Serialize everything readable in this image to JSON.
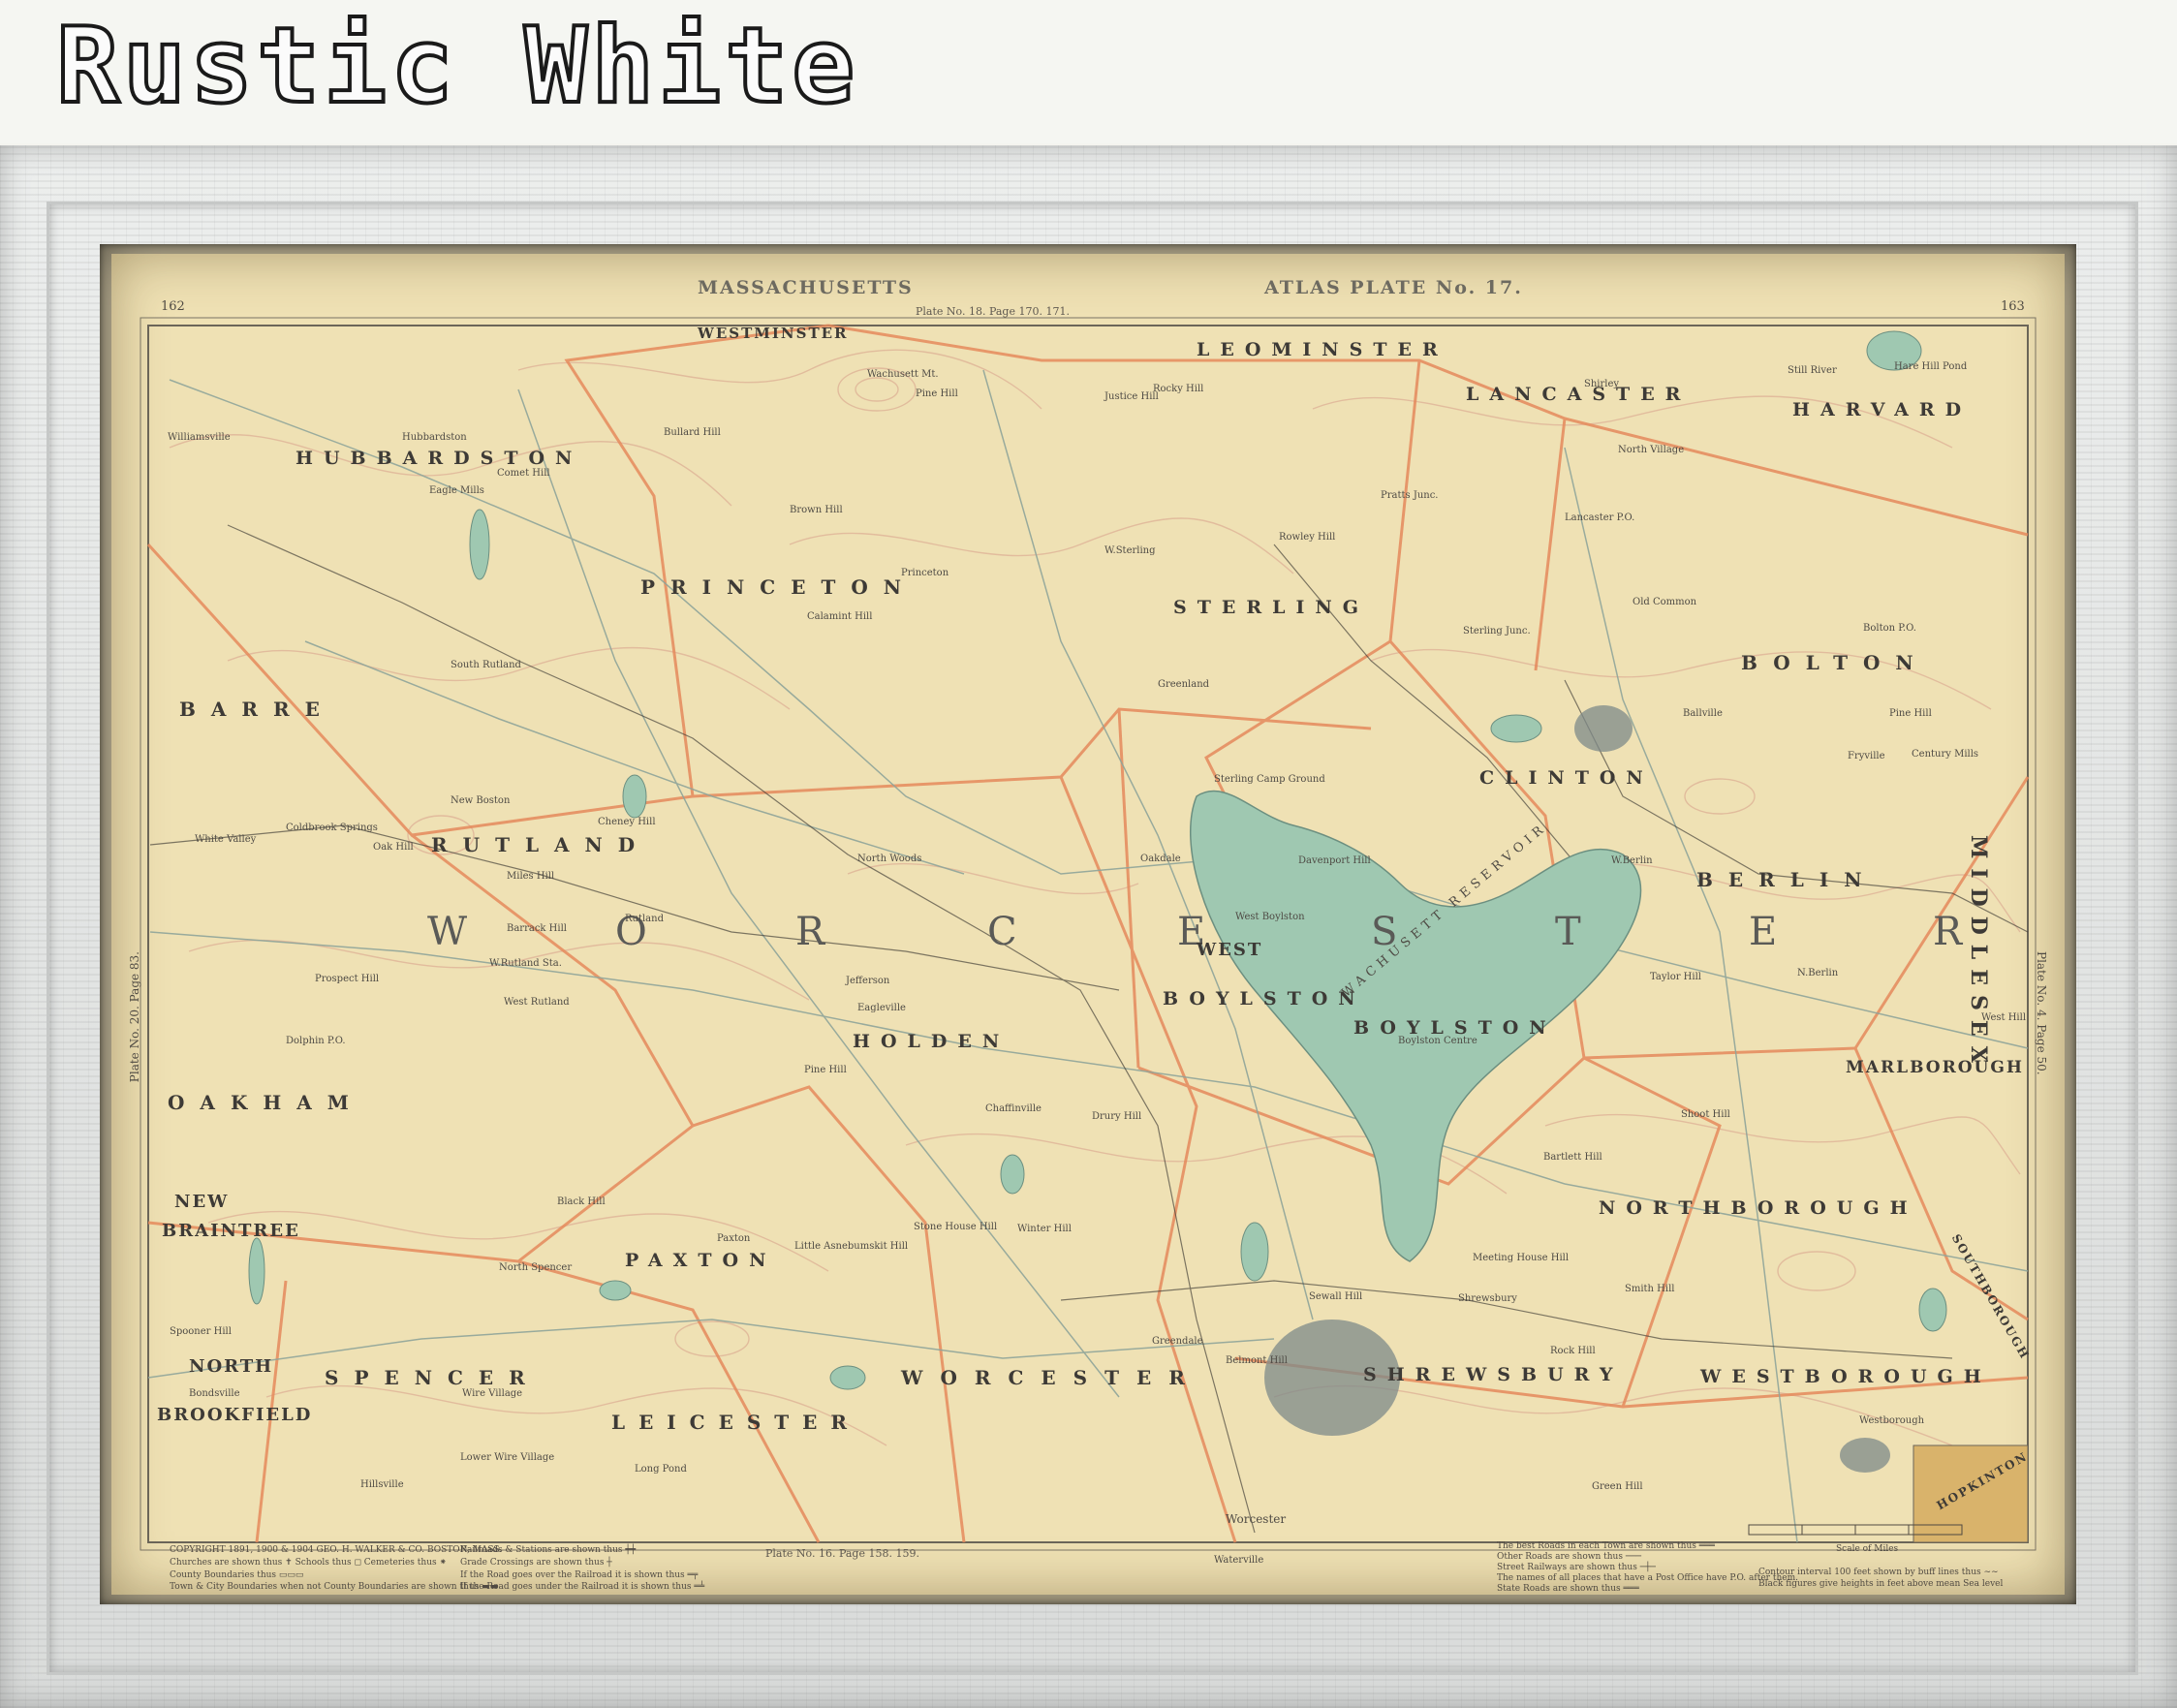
{
  "brand": {
    "title": "Rustic White"
  },
  "map": {
    "header_left": "MASSACHUSETTS",
    "header_right": "ATLAS PLATE No. 17.",
    "page_left": "162",
    "page_right": "163",
    "plate_top": "Plate No. 18. Page 170. 171.",
    "plate_left": "Plate No. 20. Page 83.",
    "plate_right": "Plate No. 4. Page 50.",
    "plate_bottom": "Plate No. 16. Page 158. 159.",
    "county": {
      "letters": [
        "W",
        "O",
        "R",
        "C",
        "E",
        "S",
        "T",
        "E",
        "R"
      ]
    },
    "reservoir": "WACHUSETT RESERVOIR",
    "towns": [
      "WESTMINSTER",
      "LEOMINSTER",
      "LANCASTER",
      "HARVARD",
      "HUBBARDSTON",
      "PRINCETON",
      "STERLING",
      "BOLTON",
      "CLINTON",
      "BARRE",
      "RUTLAND",
      "BERLIN",
      "WEST",
      "BOYLSTON",
      "BOYLSTON",
      "HOLDEN",
      "OAKHAM",
      "MARLBOROUGH",
      "NEW",
      "BRAINTREE",
      "NORTHBOROUGH",
      "PAXTON",
      "NORTH",
      "BROOKFIELD",
      "SPENCER",
      "WORCESTER",
      "SHREWSBURY",
      "WESTBOROUGH",
      "LEICESTER",
      "MIDDLESEX",
      "SOUTHBOROUGH",
      "HOPKINTON"
    ],
    "villages": [
      "Hubbardston",
      "Williamsville",
      "Eagle Mills",
      "Comet Hill",
      "Bullard Hill",
      "Wachusett Mt.",
      "Pine Hill",
      "Justice Hill",
      "Rocky Hill",
      "Pratts Junc.",
      "Lancaster P.O.",
      "North Village",
      "Shirley",
      "Still River",
      "Hare Hill Pond",
      "Princeton",
      "Brown Hill",
      "Calamint Hill",
      "W.Sterling",
      "Rowley Hill",
      "Sterling Junc.",
      "Old Common",
      "Bolton P.O.",
      "Ballville",
      "Pine Hill",
      "Century Mills",
      "Fryville",
      "South Rutland",
      "Greenland",
      "Sterling Camp Ground",
      "New Boston",
      "Cheney Hill",
      "Coldbrook Springs",
      "White Valley",
      "Oak Hill",
      "North Woods",
      "Oakdale",
      "Davenport Hill",
      "W.Berlin",
      "Miles Hill",
      "West Boylston",
      "Rutland",
      "Barrack Hill",
      "W.Rutland Sta.",
      "Prospect Hill",
      "Jefferson",
      "Eagleville",
      "Boylston Centre",
      "N.Berlin",
      "Taylor Hill",
      "West Rutland",
      "Dolphin P.O.",
      "Pine Hill",
      "Chaffinville",
      "Drury Hill",
      "Shoot Hill",
      "West Hill",
      "Black Hill",
      "Stone House Hill",
      "Winter Hill",
      "Bartlett Hill",
      "North Spencer",
      "Paxton",
      "Little Asnebumskit Hill",
      "Sewall Hill",
      "Meeting House Hill",
      "Shrewsbury",
      "Smith Hill",
      "Spooner Hill",
      "Rock Hill",
      "Bondsville",
      "Wire Village",
      "Greendale",
      "Belmont Hill",
      "Hillsville",
      "Lower Wire Village",
      "Green Hill",
      "Westborough",
      "Worcester",
      "Waterville",
      "Long Pond"
    ]
  },
  "legend": {
    "copyright": "COPYRIGHT 1891, 1900 & 1904 GEO. H. WALKER & CO. BOSTON, MASS.",
    "col1": [
      "Churches are shown thus ✝ Schools thus ◻ Cemeteries thus ⁕",
      "County Boundaries thus ▭▭▭",
      "Town & City Boundaries when not County Boundaries are shown thus ▬▬"
    ],
    "col2": [
      "Railroads & Stations are shown thus ┿┿",
      "Grade Crossings are shown thus ┼",
      "If the Road goes over the Railroad it is shown thus ═╤",
      "If the Road goes under the Railroad it is shown thus ═╧"
    ],
    "col3": [
      "The best Roads in each Town are shown thus ═══",
      "Other Roads are shown thus ───",
      "Street Railways are shown thus ─┼─",
      "The names of all places that have a Post Office have P.O. after them.",
      "State Roads are shown thus ═══"
    ],
    "scale_label": "Scale of Miles",
    "col4": [
      "Contour interval 100 feet shown by buff lines thus ∼∼",
      "Black figures give heights in feet above mean Sea level"
    ]
  }
}
